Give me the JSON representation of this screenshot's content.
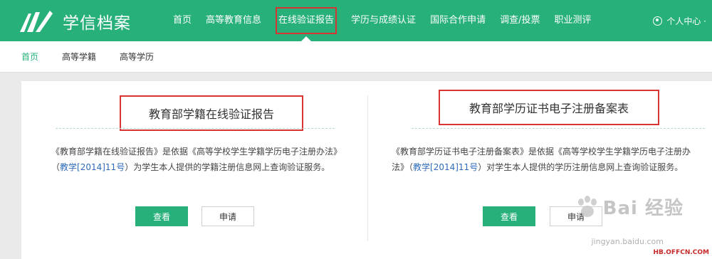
{
  "header": {
    "logo_text": "学信档案",
    "nav": [
      {
        "label": "首页",
        "active": false
      },
      {
        "label": "高等教育信息",
        "active": false
      },
      {
        "label": "在线验证报告",
        "active": true
      },
      {
        "label": "学历与成绩认证",
        "active": false
      },
      {
        "label": "国际合作申请",
        "active": false
      },
      {
        "label": "调查/投票",
        "active": false
      },
      {
        "label": "职业测评",
        "active": false
      }
    ],
    "user_label": "个人中心 ·"
  },
  "subnav": {
    "items": [
      "首页",
      "高等学籍",
      "高等学历"
    ]
  },
  "cards": [
    {
      "title": "教育部学籍在线验证报告",
      "desc_before": "《教育部学籍在线验证报告》是依据《高等学校学生学籍学历电子注册办法》（",
      "desc_link": "教学[2014]11号",
      "desc_after": "）为学生本人提供的学籍注册信息网上查询验证服务。",
      "primary_button": "查看",
      "secondary_button": "申请"
    },
    {
      "title": "教育部学历证书电子注册备案表",
      "desc_before": "《教育部学历证书电子注册备案表》是依据《高等学校学生学籍学历电子注册办法》（",
      "desc_link": "教学[2014]11号",
      "desc_after": "）对学生本人提供的学历注册信息网上查询验证服务。",
      "primary_button": "查看",
      "secondary_button": "申请"
    }
  ],
  "watermark": {
    "brand": "Bai 经验",
    "url": "jingyan.baidu.com",
    "site": "HB.OFFCN.COM"
  },
  "colors": {
    "brand_green": "#27b07a",
    "highlight_red": "#d93434",
    "link_blue": "#2f6bbd"
  }
}
